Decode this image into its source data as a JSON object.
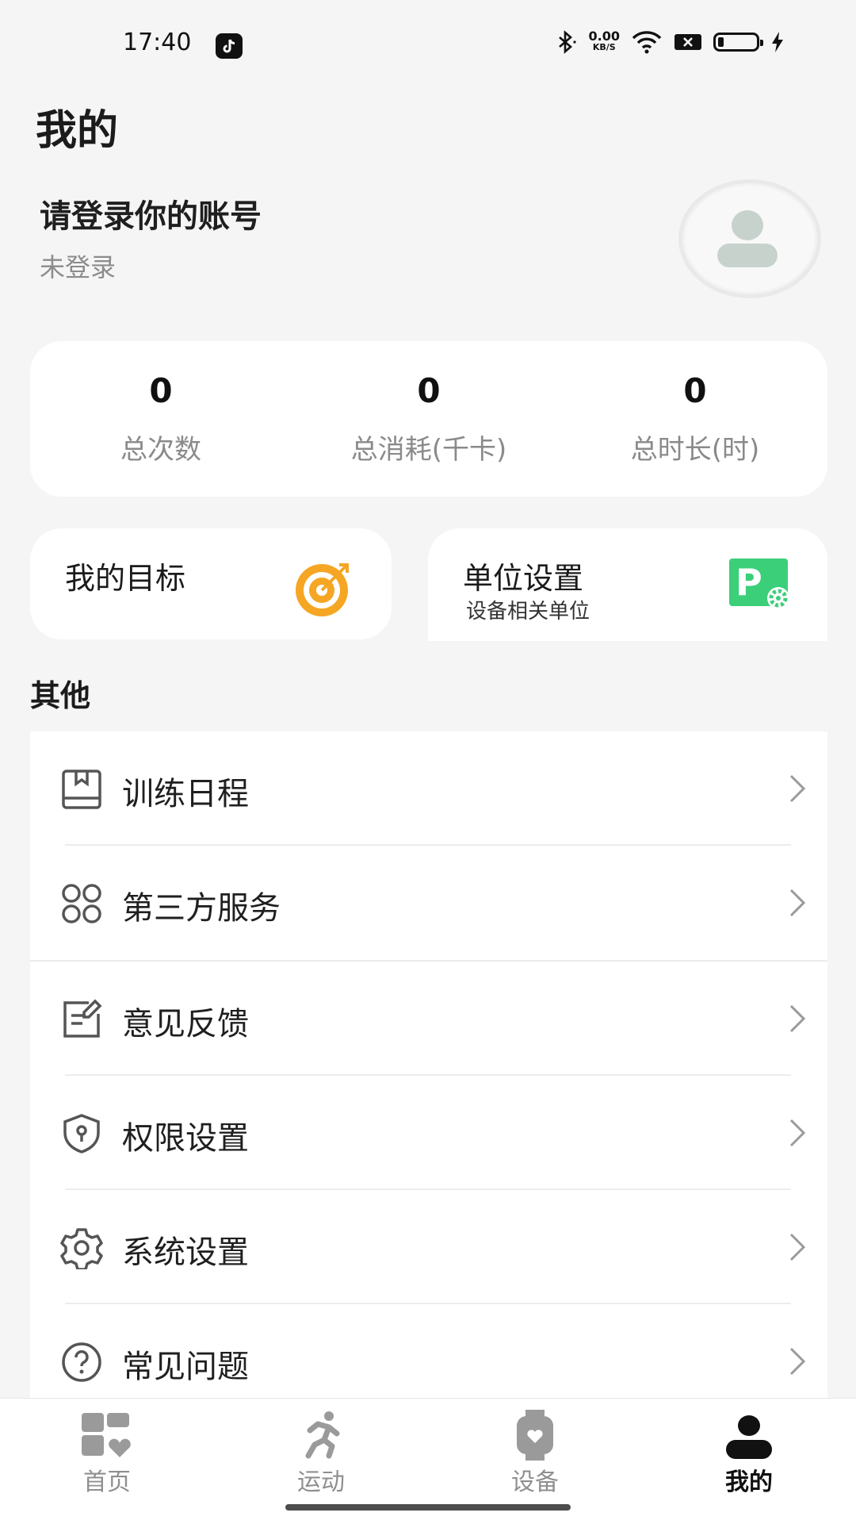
{
  "status_bar": {
    "time": "17:40",
    "net_speed_value": "0.00",
    "net_speed_unit": "KB/S"
  },
  "page_title": "我的",
  "account": {
    "title": "请登录你的账号",
    "status": "未登录"
  },
  "stats": [
    {
      "value": "0",
      "label": "总次数"
    },
    {
      "value": "0",
      "label": "总消耗(千卡)"
    },
    {
      "value": "0",
      "label": "总时长(时)"
    }
  ],
  "goal_card": {
    "title": "我的目标",
    "accent": "#f5a623"
  },
  "unit_card": {
    "title": "单位设置",
    "subtitle": "设备相关单位",
    "accent": "#3ccf7a"
  },
  "section_title": "其他",
  "menu": [
    {
      "label": "训练日程",
      "icon": "calendar-book-icon"
    },
    {
      "label": "第三方服务",
      "icon": "apps-grid-icon"
    },
    {
      "label": "意见反馈",
      "icon": "feedback-edit-icon"
    },
    {
      "label": "权限设置",
      "icon": "shield-lock-icon"
    },
    {
      "label": "系统设置",
      "icon": "gear-icon"
    },
    {
      "label": "常见问题",
      "icon": "question-circle-icon"
    }
  ],
  "tabs": [
    {
      "label": "首页",
      "icon": "home-heart-icon"
    },
    {
      "label": "运动",
      "icon": "runner-icon"
    },
    {
      "label": "设备",
      "icon": "watch-icon"
    },
    {
      "label": "我的",
      "icon": "person-icon",
      "active": true
    }
  ],
  "colors": {
    "background": "#f5f5f5",
    "card": "#ffffff",
    "muted_text": "#8a8a8a"
  }
}
